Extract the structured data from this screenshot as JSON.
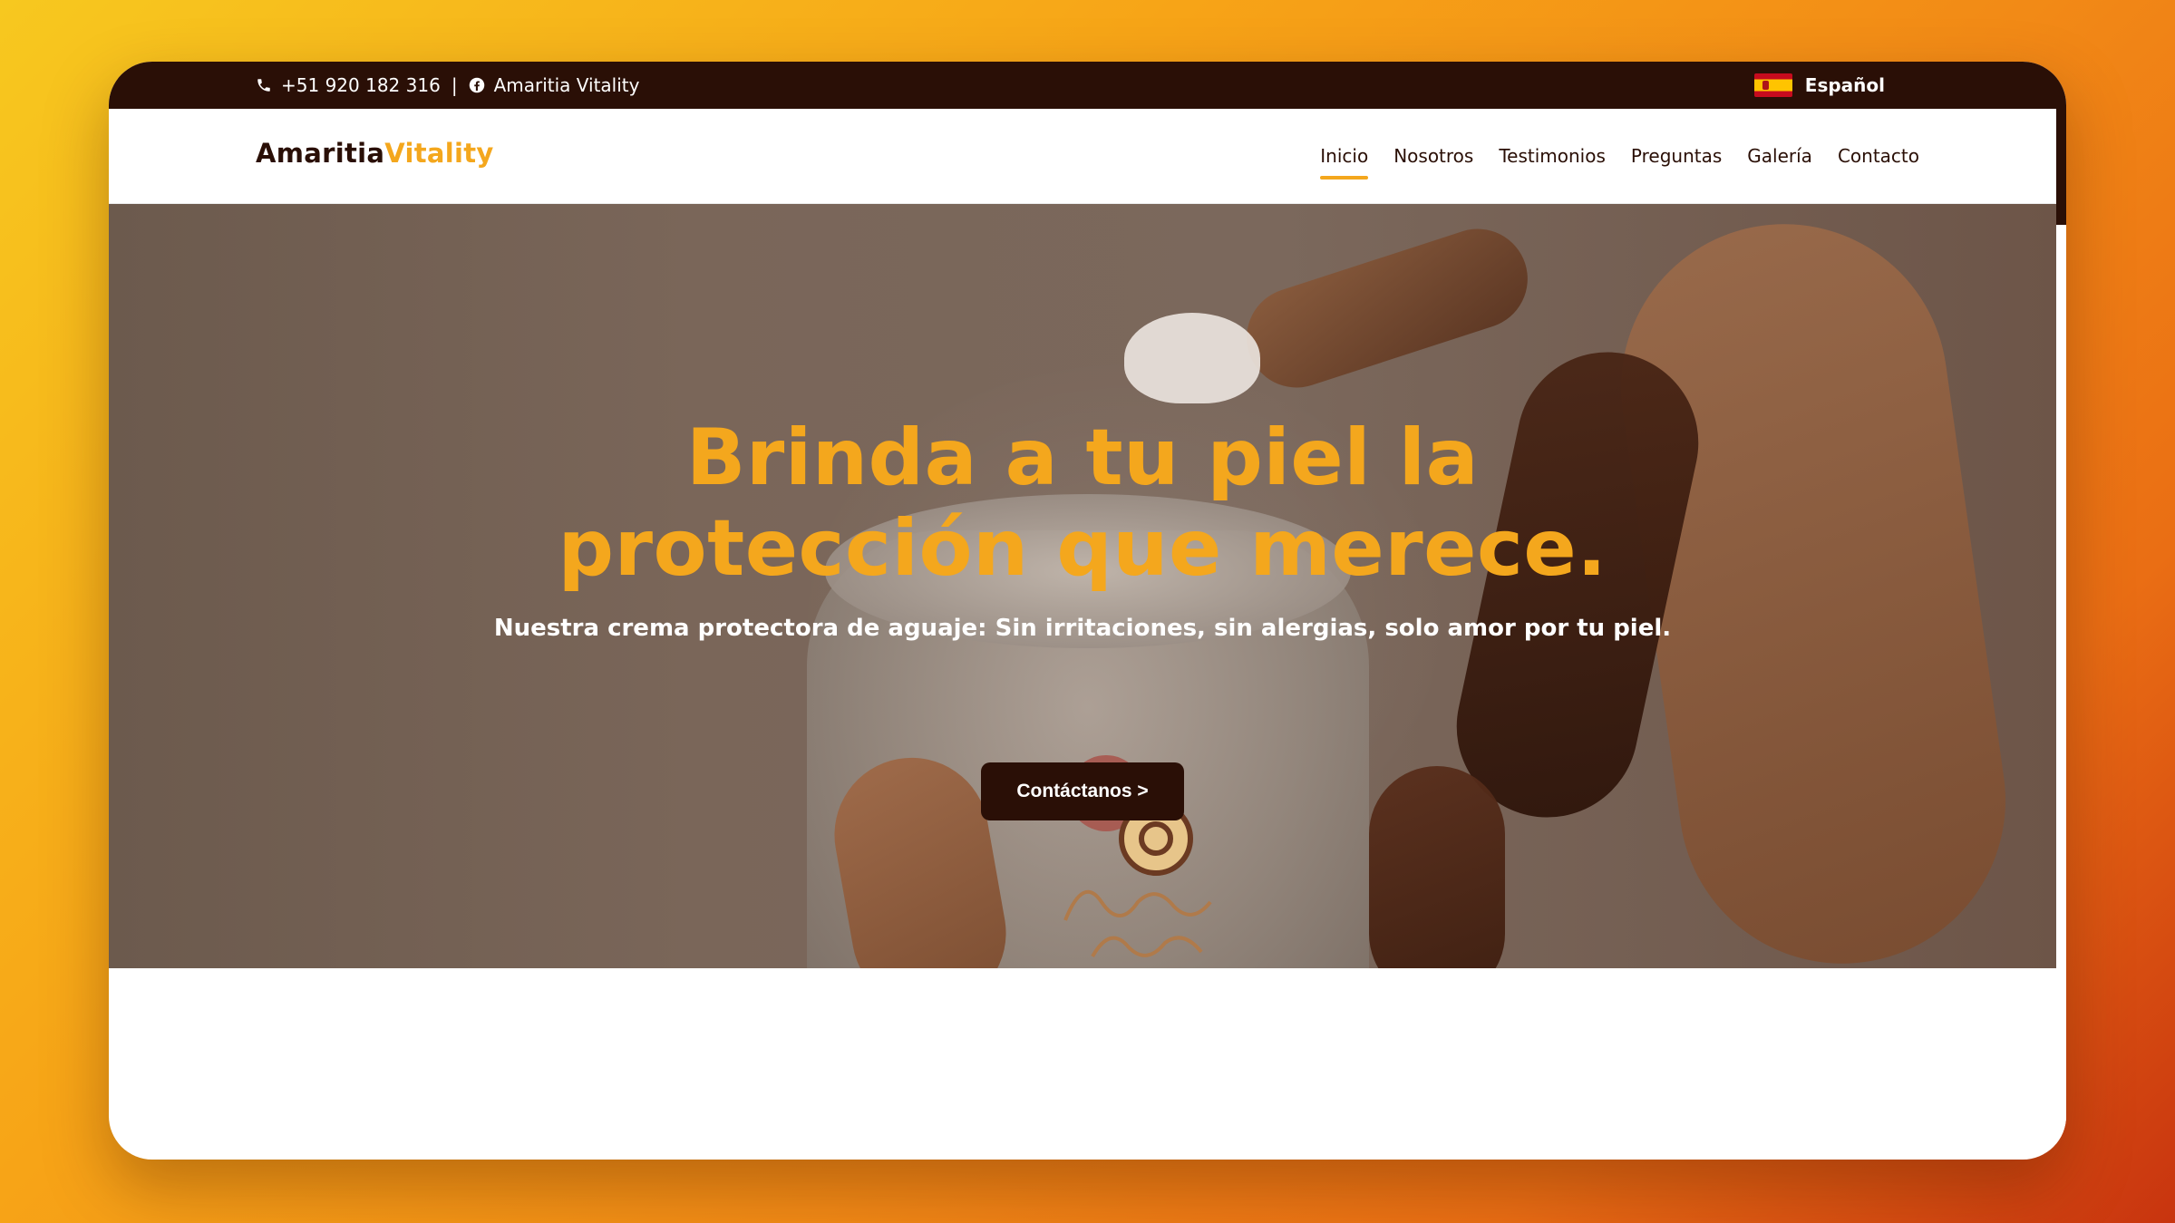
{
  "topbar": {
    "phone": "+51 920 182 316",
    "separator": "|",
    "facebook": "Amaritia Vitality",
    "language": "Español"
  },
  "brand": {
    "part1": "Amaritia",
    "part2": "Vitality"
  },
  "nav": {
    "items": [
      {
        "label": "Inicio",
        "active": true
      },
      {
        "label": "Nosotros",
        "active": false
      },
      {
        "label": "Testimonios",
        "active": false
      },
      {
        "label": "Preguntas",
        "active": false
      },
      {
        "label": "Galería",
        "active": false
      },
      {
        "label": "Contacto",
        "active": false
      }
    ]
  },
  "hero": {
    "title_line1": "Brinda a tu piel la",
    "title_line2": "protección que merece.",
    "subtitle": "Nuestra crema protectora de aguaje: Sin irritaciones, sin alergias, solo amor por tu piel.",
    "cta_label": "Contáctanos >"
  },
  "colors": {
    "dark_brown": "#2a0f06",
    "accent": "#f4a71d"
  },
  "icons": {
    "phone": "phone-icon",
    "facebook": "facebook-icon",
    "flag": "spain-flag-icon"
  }
}
